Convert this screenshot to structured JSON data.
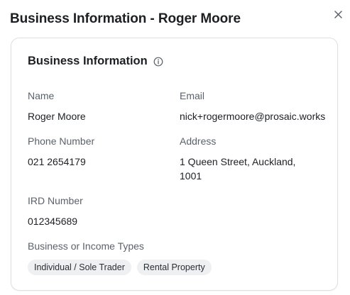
{
  "dialog": {
    "title": "Business Information - Roger Moore",
    "close_icon": "close-icon"
  },
  "card": {
    "title": "Business Information",
    "info_icon": "info-circle-icon"
  },
  "fields": {
    "name": {
      "label": "Name",
      "value": "Roger Moore"
    },
    "email": {
      "label": "Email",
      "value": "nick+rogermoore@prosaic.works"
    },
    "phone": {
      "label": "Phone Number",
      "value": "021 2654179"
    },
    "address": {
      "label": "Address",
      "line1": "1 Queen Street, Auckland,",
      "line2": "1001"
    },
    "ird": {
      "label": "IRD Number",
      "value": "012345689"
    },
    "types": {
      "label": "Business or Income Types",
      "items": [
        "Individual / Sole Trader",
        "Rental Property"
      ]
    }
  }
}
